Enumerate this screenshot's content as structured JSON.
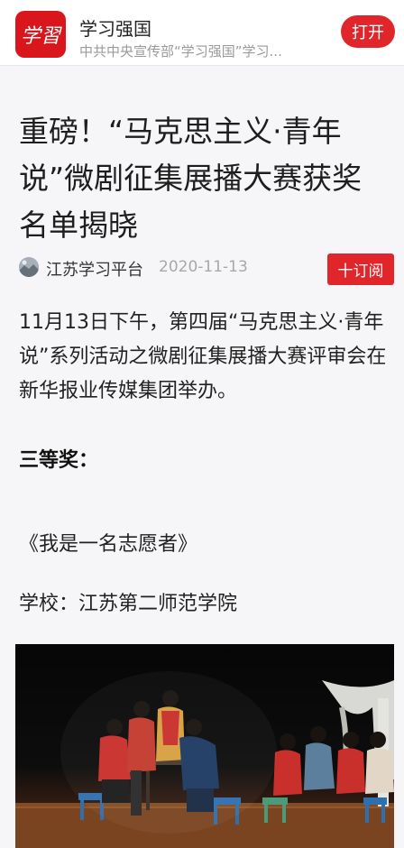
{
  "app_banner": {
    "logo_text": "学習",
    "app_name": "学习强国",
    "description": "中共中央宣传部“学习强国”学习...",
    "open_label": "打开"
  },
  "article": {
    "title": "重磅！“马克思主义·青年说”微剧征集展播大赛获奖名单揭晓",
    "source": "江苏学习平台",
    "date": "2020-11-13",
    "subscribe_label": "十订阅",
    "lead": "11月13日下午，第四届“马克思主义·青年说”系列活动之微剧征集展播大赛评审会在新华报业传媒集团举办。",
    "section_heading": "三等奖：",
    "work_title": "《我是一名志愿者》",
    "school_line": "学校：江苏第二师范学院"
  },
  "colors": {
    "brand_red": "#e0252b",
    "background": "#f6f6f8"
  }
}
